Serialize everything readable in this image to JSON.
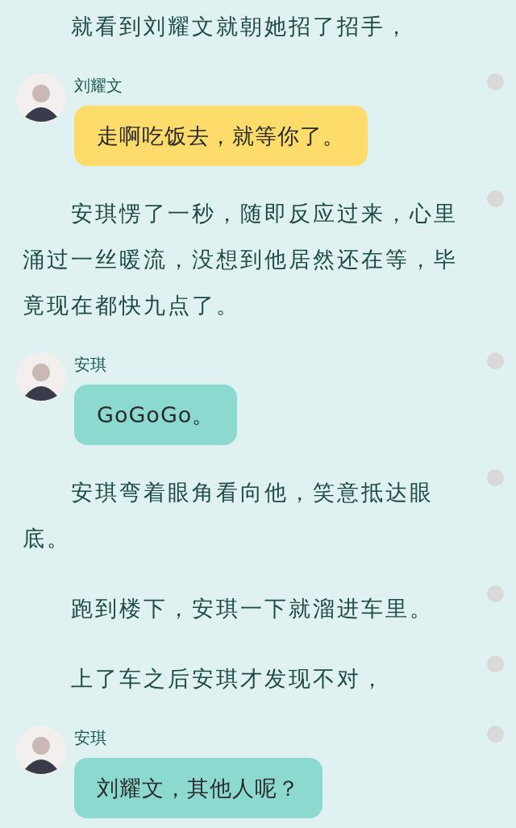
{
  "items": [
    {
      "kind": "paragraph",
      "text": "就看到刘耀文就朝她招了招手，",
      "marked": false
    },
    {
      "kind": "message",
      "speaker": "刘耀文",
      "text": "走啊吃饭去，就等你了。",
      "color": "#fddc6c",
      "marked": true
    },
    {
      "kind": "paragraph",
      "text": "安琪愣了一秒，随即反应过来，心里涌过一丝暖流，没想到他居然还在等，毕竟现在都快九点了。",
      "marked": true
    },
    {
      "kind": "message",
      "speaker": "安琪",
      "text": "GoGoGo。",
      "color": "#8bd9cf",
      "marked": true
    },
    {
      "kind": "paragraph",
      "text": "安琪弯着眼角看向他，笑意抵达眼底。",
      "marked": true
    },
    {
      "kind": "paragraph",
      "text": "跑到楼下，安琪一下就溜进车里。",
      "marked": true
    },
    {
      "kind": "paragraph",
      "text": "上了车之后安琪才发现不对，",
      "marked": true
    },
    {
      "kind": "message",
      "speaker": "安琪",
      "text": "刘耀文，其他人呢？",
      "color": "#8bd9cf",
      "marked": true
    }
  ]
}
